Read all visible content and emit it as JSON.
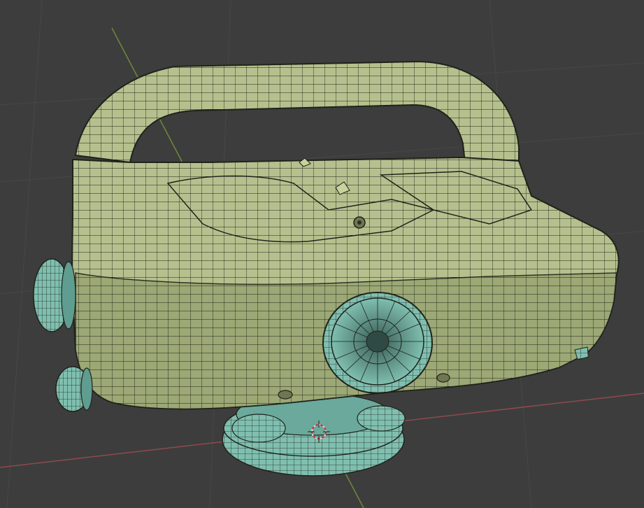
{
  "viewport": {
    "background_color": "#3d3d3d",
    "grid_color": "#464646",
    "x_axis_color": "#8e4a4f",
    "y_axis_color": "#6c8a3a"
  },
  "model": {
    "body_color": "#b6c08e",
    "body_shadow_color": "#8f9a68",
    "parts_color": "#7fbfb0",
    "parts_shadow_color": "#5e9d90",
    "wire_color": "#1f231a"
  },
  "cursor_3d": {
    "icon": "3d-cursor-icon",
    "ring_color": "#d9d9d9",
    "accent_color": "#d03030"
  }
}
